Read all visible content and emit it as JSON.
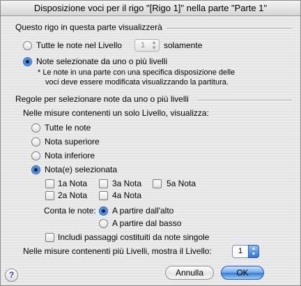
{
  "window": {
    "title": "Disposizione voci per il rigo \"[Rigo 1]\" nella parte \"Parte 1\""
  },
  "display_group": {
    "title": "Questo rigo in questa parte visualizzerà",
    "option_all": {
      "label": "Tutte le note nel Livello",
      "selected": false
    },
    "layer_value": "1",
    "only_label": "solamente",
    "option_selected": {
      "label": "Note selezionate da uno o più livelli",
      "selected": true
    },
    "note_line1": "* Le note in una parte con una specifica disposizione delle",
    "note_line2": "voci deve essere modificata visualizzando la partitura."
  },
  "rules_group": {
    "title": "Regole per selezionare note da uno o più livelli",
    "single_layer_label": "Nelle misure contenenti un solo Livello, visualizza:",
    "options": [
      {
        "label": "Tutte le note",
        "selected": false
      },
      {
        "label": "Nota superiore",
        "selected": false
      },
      {
        "label": "Nota inferiore",
        "selected": false
      },
      {
        "label": "Nota(e) selezionata",
        "selected": true
      }
    ],
    "notes": [
      {
        "label": "1a Nota",
        "checked": false
      },
      {
        "label": "3a Nota",
        "checked": false
      },
      {
        "label": "5a Nota",
        "checked": false
      },
      {
        "label": "2a Nota",
        "checked": false
      },
      {
        "label": "4a Nota",
        "checked": false
      }
    ],
    "count_label": "Conta le note:",
    "count_top": {
      "label": "A partire dall'alto",
      "selected": true
    },
    "count_bottom": {
      "label": "A partire dal basso",
      "selected": false
    },
    "include_single": {
      "label": "Includi passaggi costituiti da note singole",
      "checked": false
    },
    "multi_layer_label": "Nelle misure contenenti più Livelli, mostra il Livello:",
    "multi_layer_value": "1"
  },
  "buttons": {
    "help": "?",
    "cancel": "Annulla",
    "ok": "OK"
  }
}
